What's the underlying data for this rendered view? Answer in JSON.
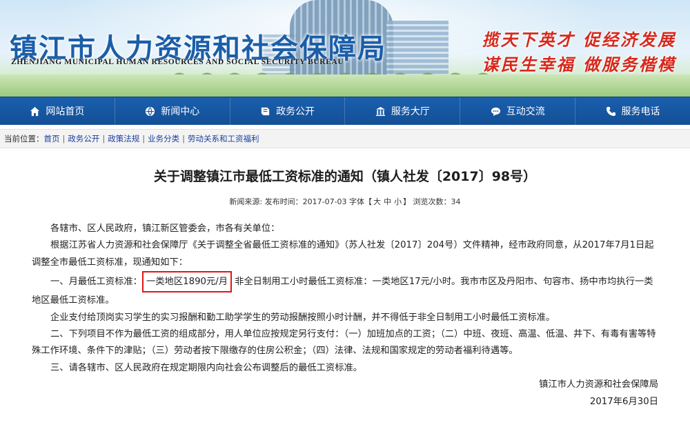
{
  "header": {
    "org_name_cn": "镇江市人力资源和社会保障局",
    "org_name_en": "ZHENJIANG MUNICIPAL HUMAN RESOURCES AND SOCIAL SECURITY BUREAU",
    "slogan_line1": "揽天下英才  促经济发展",
    "slogan_line2": "谋民生幸福  做服务楷模"
  },
  "nav": {
    "items": [
      {
        "label": "网站首页",
        "icon": "home-icon"
      },
      {
        "label": "新闻中心",
        "icon": "globe-icon"
      },
      {
        "label": "政务公开",
        "icon": "book-icon"
      },
      {
        "label": "服务大厅",
        "icon": "building-icon"
      },
      {
        "label": "互动交流",
        "icon": "chat-icon"
      },
      {
        "label": "服务电话",
        "icon": "phone-icon"
      }
    ]
  },
  "breadcrumb": {
    "prefix": "当前位置：",
    "items": [
      "首页",
      "政务公开",
      "政策法规",
      "业务分类",
      "劳动关系和工资福利"
    ]
  },
  "article": {
    "title": "关于调整镇江市最低工资标准的通知（镇人社发〔2017〕98号）",
    "meta_before": "新闻来源: 发布时间：2017-07-03 字体【",
    "font_large": "大",
    "font_medium": "中",
    "font_small": "小",
    "meta_after": "】 浏览次数：34",
    "p1": "各辖市、区人民政府，镇江新区管委会，市各有关单位：",
    "p2": "根据江苏省人力资源和社会保障厅《关于调整全省最低工资标准的通知》（苏人社发〔2017〕204号）文件精神，经市政府同意，从2017年7月1日起调整全市最低工资标准，现通知如下：",
    "p3_prefix": "一、月最低工资标准：",
    "p3_highlight": "一类地区1890元/月",
    "p3_suffix": "非全日制用工小时最低工资标准：一类地区17元/小时。我市市区及丹阳市、句容市、扬中市均执行一类地区最低工资标准。",
    "p4": "企业支付给顶岗实习学生的实习报酬和勤工助学学生的劳动报酬按照小时计酬，并不得低于非全日制用工小时最低工资标准。",
    "p5": "二、下列项目不作为最低工资的组成部分，用人单位应按规定另行支付：（一）加班加点的工资；（二）中班、夜班、高温、低温、井下、有毒有害等特殊工作环境、条件下的津贴；（三）劳动者按下限缴存的住房公积金；（四）法律、法规和国家规定的劳动者福利待遇等。",
    "p6": "三、请各辖市、区人民政府在规定期限内向社会公布调整后的最低工资标准。",
    "signature": "镇江市人力资源和社会保障局",
    "date": "2017年6月30日"
  }
}
